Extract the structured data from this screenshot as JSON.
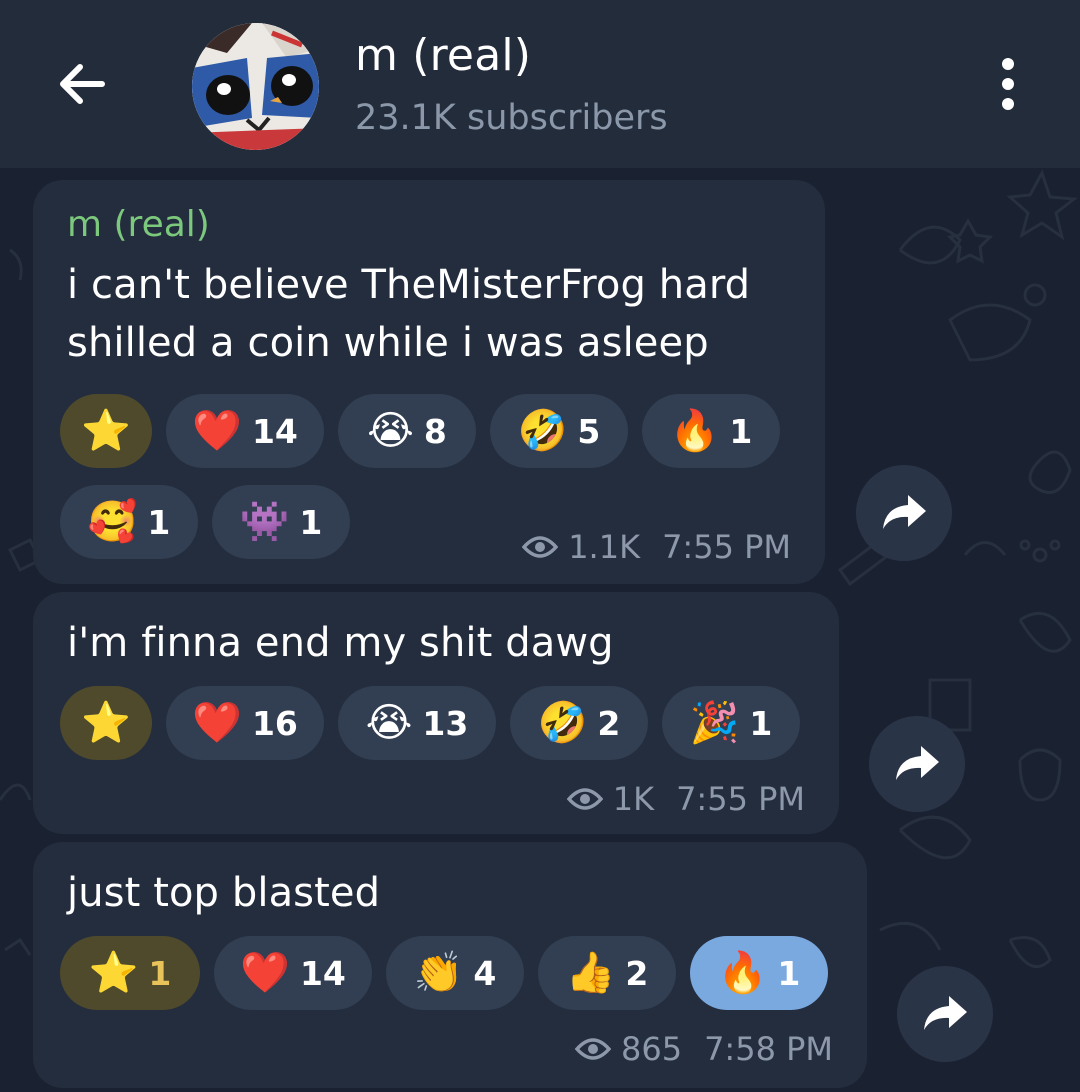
{
  "header": {
    "title": "m (real)",
    "subtitle": "23.1K subscribers"
  },
  "messages": [
    {
      "sender": "m (real)",
      "lines": [
        "i can't believe TheMisterFrog hard",
        "shilled a coin while i was asleep"
      ],
      "reactions": [
        {
          "emoji": "⭐",
          "count": ""
        },
        {
          "emoji": "❤️",
          "count": "14"
        },
        {
          "emoji": "😭",
          "count": "8"
        },
        {
          "emoji": "🤣",
          "count": "5"
        },
        {
          "emoji": "🔥",
          "count": "1"
        },
        {
          "emoji": "🥰",
          "count": "1"
        },
        {
          "emoji": "👾",
          "count": "1"
        }
      ],
      "views": "1.1K",
      "time": "7:55 PM"
    },
    {
      "lines": [
        "i'm finna end my shit dawg"
      ],
      "reactions": [
        {
          "emoji": "⭐",
          "count": ""
        },
        {
          "emoji": "❤️",
          "count": "16"
        },
        {
          "emoji": "😭",
          "count": "13"
        },
        {
          "emoji": "🤣",
          "count": "2"
        },
        {
          "emoji": "🎉",
          "count": "1"
        }
      ],
      "views": "1K",
      "time": "7:55 PM"
    },
    {
      "lines": [
        "just top blasted"
      ],
      "reactions": [
        {
          "emoji": "⭐",
          "count": "1"
        },
        {
          "emoji": "❤️",
          "count": "14"
        },
        {
          "emoji": "👏",
          "count": "4"
        },
        {
          "emoji": "👍",
          "count": "2"
        },
        {
          "emoji": "🔥",
          "count": "1"
        }
      ],
      "views": "865",
      "time": "7:58 PM"
    }
  ],
  "colors": {
    "background": "#1a2130",
    "header": "#232c3b",
    "bubble": "#232d3d",
    "sender": "#7cc87c",
    "star_reaction": "#4f4a2c",
    "selected_reaction": "#7aa9e0",
    "meta": "#8d99ab"
  }
}
